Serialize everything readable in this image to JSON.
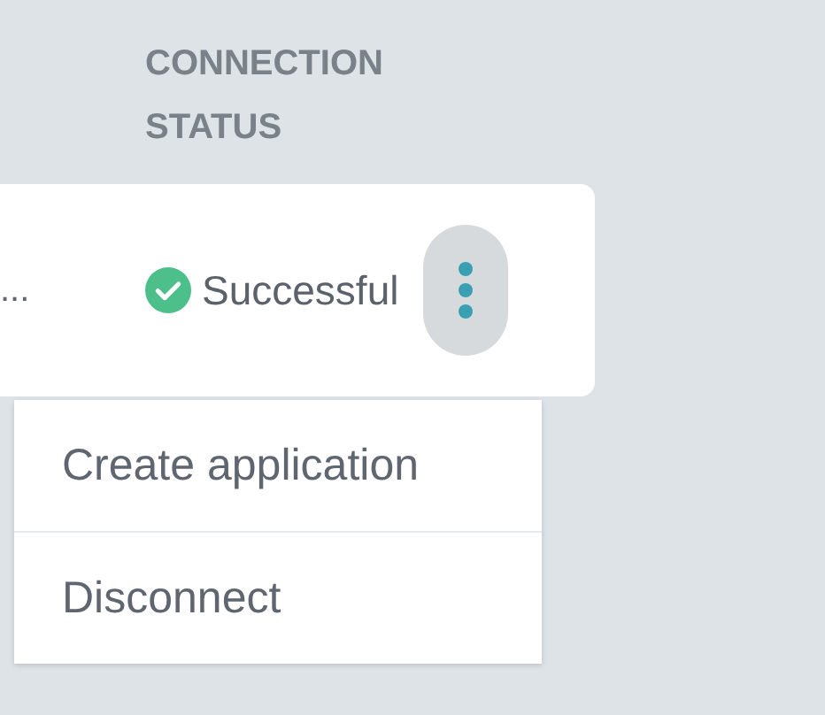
{
  "table": {
    "columns": [
      {
        "label": "CONNECTION STATUS"
      }
    ],
    "row": {
      "cell_1": "...",
      "status": {
        "label": "Successful",
        "kind": "success"
      },
      "actions_open": true
    }
  },
  "menu": {
    "items": [
      {
        "label": "Create application"
      },
      {
        "label": "Disconnect"
      }
    ]
  }
}
